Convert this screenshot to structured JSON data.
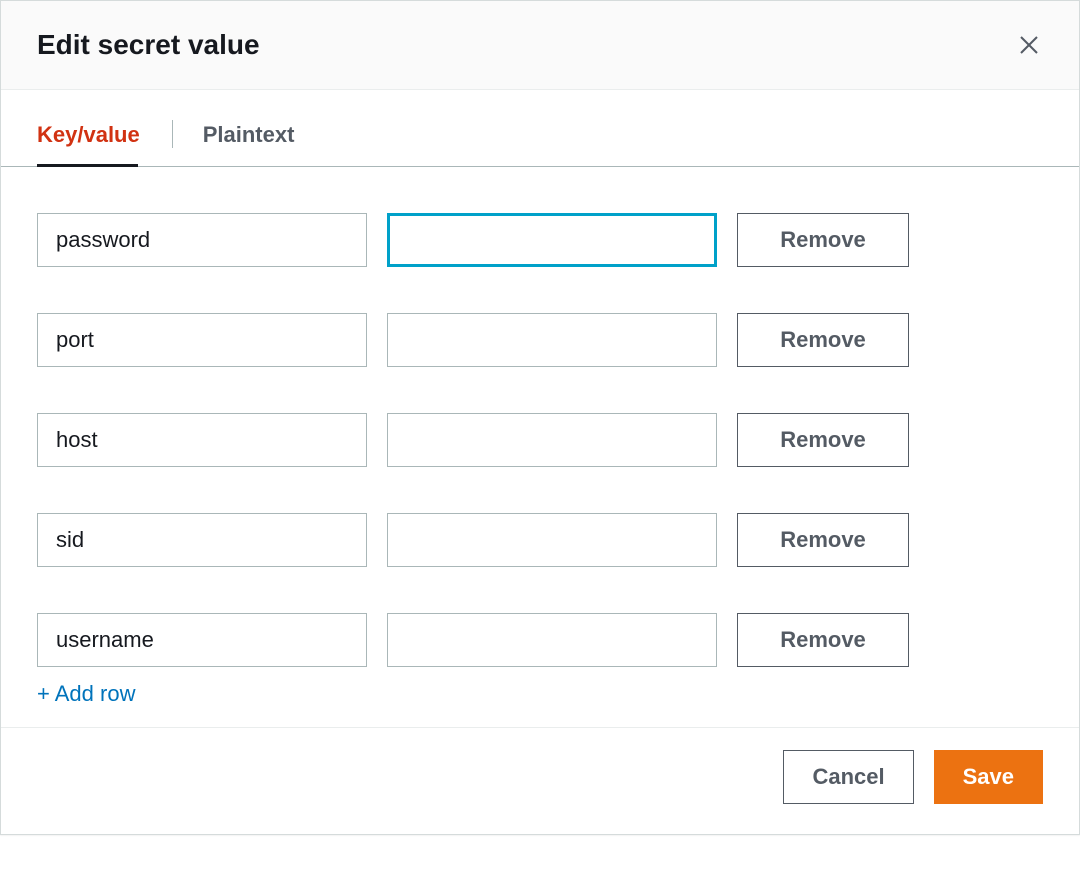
{
  "modal": {
    "title": "Edit secret value"
  },
  "tabs": [
    {
      "label": "Key/value",
      "active": true
    },
    {
      "label": "Plaintext",
      "active": false
    }
  ],
  "rows": [
    {
      "key": "password",
      "value": "",
      "focused": true
    },
    {
      "key": "port",
      "value": "",
      "focused": false
    },
    {
      "key": "host",
      "value": "",
      "focused": false
    },
    {
      "key": "sid",
      "value": "",
      "focused": false
    },
    {
      "key": "username",
      "value": "",
      "focused": false
    }
  ],
  "buttons": {
    "remove": "Remove",
    "add_row": "+ Add row",
    "cancel": "Cancel",
    "save": "Save"
  }
}
